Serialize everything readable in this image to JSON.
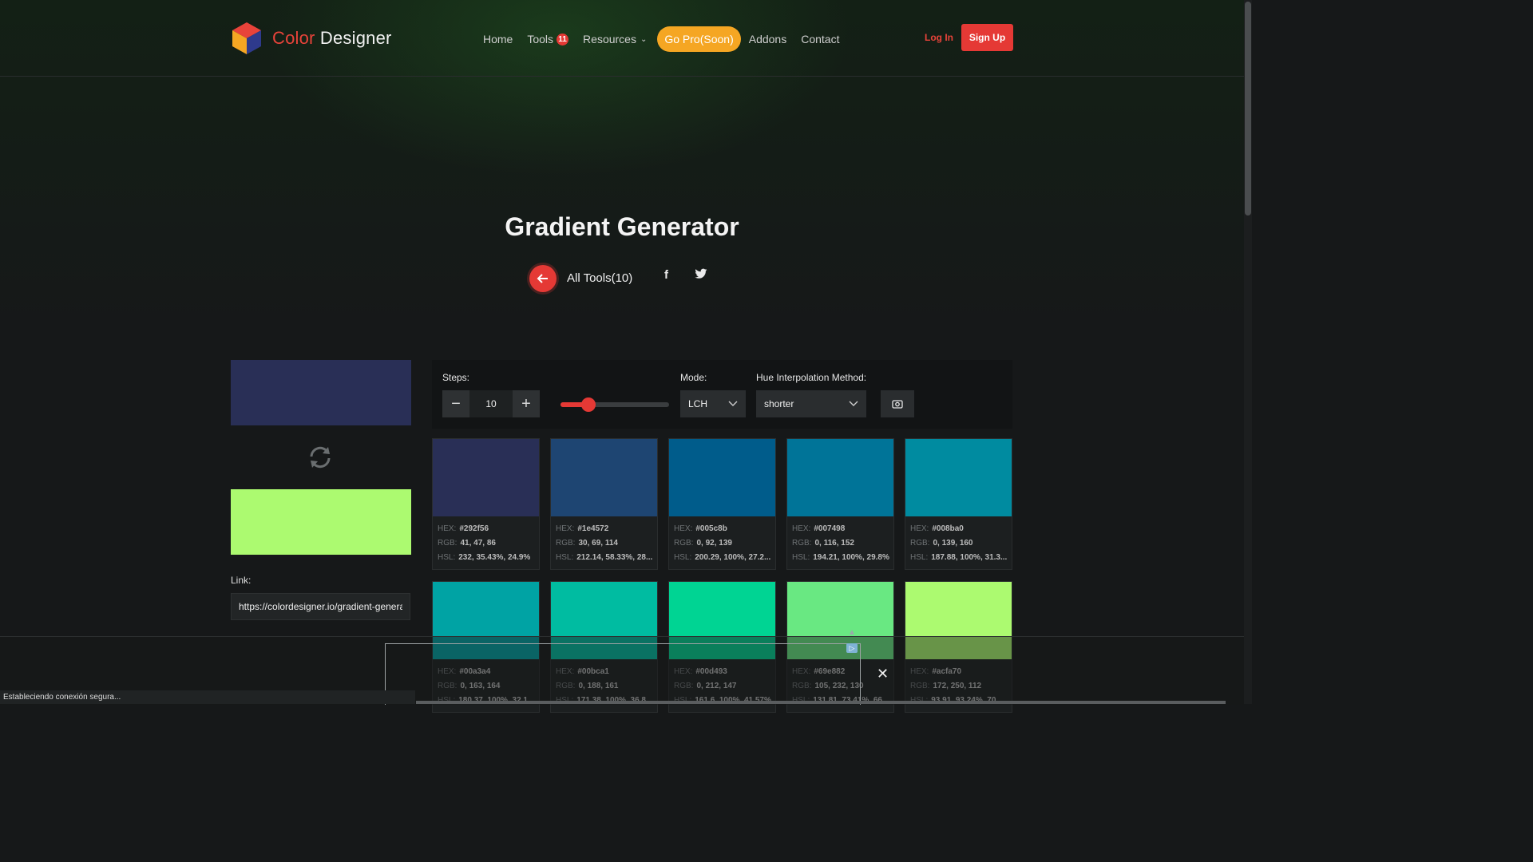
{
  "brand": {
    "word1": "Color",
    "word2": "Designer"
  },
  "nav": {
    "home": "Home",
    "tools": "Tools",
    "tools_badge": "11",
    "resources": "Resources",
    "go_pro": "Go Pro(Soon)",
    "addons": "Addons",
    "contact": "Contact"
  },
  "auth": {
    "login": "Log In",
    "signup": "Sign Up"
  },
  "hero": {
    "title": "Gradient Generator",
    "all_tools": "All Tools(10)"
  },
  "controls": {
    "steps_label": "Steps:",
    "steps_value": "10",
    "mode_label": "Mode:",
    "mode_value": "LCH",
    "hue_label": "Hue Interpolation Method:",
    "hue_value": "shorter",
    "slider_fraction": 0.26
  },
  "gradient": {
    "start_color": "#292f56",
    "end_color": "#acfa70"
  },
  "link": {
    "label": "Link:",
    "value": "https://colordesigner.io/gradient-generator"
  },
  "field_labels": {
    "hex": "HEX:",
    "rgb": "RGB:",
    "hsl": "HSL:"
  },
  "colors": [
    {
      "hex": "#292f56",
      "rgb": "41, 47, 86",
      "hsl": "232, 35.43%, 24.9%"
    },
    {
      "hex": "#1e4572",
      "rgb": "30, 69, 114",
      "hsl": "212.14, 58.33%, 28..."
    },
    {
      "hex": "#005c8b",
      "rgb": "0, 92, 139",
      "hsl": "200.29, 100%, 27.2..."
    },
    {
      "hex": "#007498",
      "rgb": "0, 116, 152",
      "hsl": "194.21, 100%, 29.8%"
    },
    {
      "hex": "#008ba0",
      "rgb": "0, 139, 160",
      "hsl": "187.88, 100%, 31.3..."
    },
    {
      "hex": "#00a3a4",
      "rgb": "0, 163, 164",
      "hsl": "180.37, 100%, 32.1..."
    },
    {
      "hex": "#00bca1",
      "rgb": "0, 188, 161",
      "hsl": "171.38, 100%, 36.8..."
    },
    {
      "hex": "#00d493",
      "rgb": "0, 212, 147",
      "hsl": "161.6, 100%, 41.57%"
    },
    {
      "hex": "#69e882",
      "rgb": "105, 232, 130",
      "hsl": "131.81, 73.41%, 66..."
    },
    {
      "hex": "#acfa70",
      "rgb": "172, 250, 112",
      "hsl": "93.91, 93.24%, 70..."
    }
  ],
  "status_bar": "Estableciendo conexión segura...",
  "icons": {
    "back": "arrow-left-icon",
    "facebook": "facebook-icon",
    "twitter": "twitter-icon",
    "swap": "swap-icon",
    "camera": "screenshot-icon",
    "close": "close-icon"
  },
  "accent": "#e53935",
  "pro_color": "#f5a623"
}
